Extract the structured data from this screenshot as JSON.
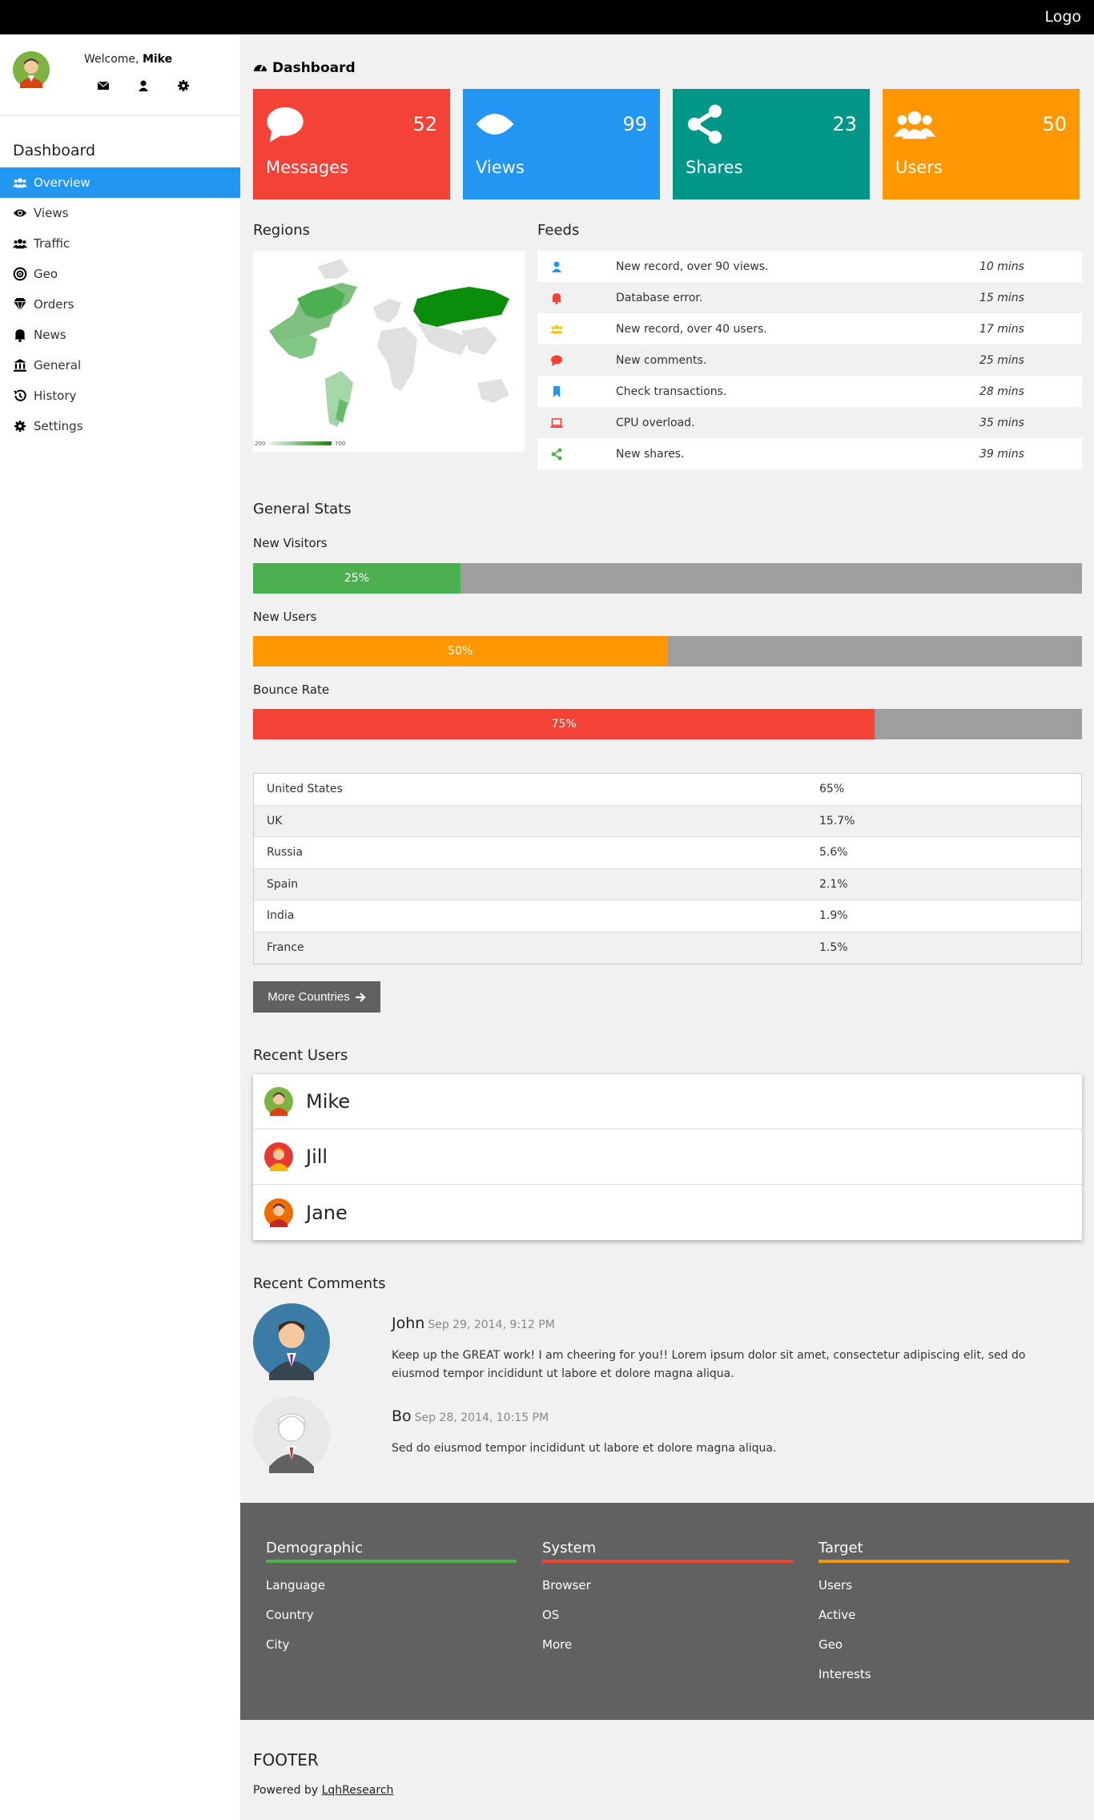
{
  "topbar": {
    "logo": "Logo"
  },
  "profile": {
    "welcome_prefix": "Welcome,",
    "user_name": "Mike"
  },
  "sidebar": {
    "title": "Dashboard",
    "items": [
      {
        "label": "Overview",
        "icon": "users-icon",
        "active": true
      },
      {
        "label": "Views",
        "icon": "eye-icon"
      },
      {
        "label": "Traffic",
        "icon": "users-icon"
      },
      {
        "label": "Geo",
        "icon": "bullseye-icon"
      },
      {
        "label": "Orders",
        "icon": "diamond-icon"
      },
      {
        "label": "News",
        "icon": "bell-icon"
      },
      {
        "label": "General",
        "icon": "bank-icon"
      },
      {
        "label": "History",
        "icon": "history-icon"
      },
      {
        "label": "Settings",
        "icon": "gear-icon"
      }
    ]
  },
  "main": {
    "title": "Dashboard",
    "cards": [
      {
        "label": "Messages",
        "value": "52",
        "color": "#f44336",
        "icon": "comment-icon"
      },
      {
        "label": "Views",
        "value": "99",
        "color": "#2196F3",
        "icon": "eye-icon"
      },
      {
        "label": "Shares",
        "value": "23",
        "color": "#009688",
        "icon": "share-icon"
      },
      {
        "label": "Users",
        "value": "50",
        "color": "#ff9800",
        "icon": "users-icon"
      }
    ],
    "regions_title": "Regions",
    "map_legend_min": "200",
    "map_legend_max": "700",
    "feeds_title": "Feeds",
    "feeds": [
      {
        "text": "New record, over 90 views.",
        "time": "10 mins",
        "icon": "user-icon",
        "color": "#2196F3"
      },
      {
        "text": "Database error.",
        "time": "15 mins",
        "icon": "bell-icon",
        "color": "#f44336"
      },
      {
        "text": "New record, over 40 users.",
        "time": "17 mins",
        "icon": "users-icon",
        "color": "#ffc107"
      },
      {
        "text": "New comments.",
        "time": "25 mins",
        "icon": "comment-icon",
        "color": "#f44336"
      },
      {
        "text": "Check transactions.",
        "time": "28 mins",
        "icon": "bookmark-icon",
        "color": "#2196F3"
      },
      {
        "text": "CPU overload.",
        "time": "35 mins",
        "icon": "laptop-icon",
        "color": "#f44336"
      },
      {
        "text": "New shares.",
        "time": "39 mins",
        "icon": "share-icon",
        "color": "#4CAF50"
      }
    ],
    "stats_title": "General Stats",
    "stats": [
      {
        "label": "New Visitors",
        "value": 25,
        "text": "25%",
        "color": "#4CAF50"
      },
      {
        "label": "New Users",
        "value": 50,
        "text": "50%",
        "color": "#ff9800"
      },
      {
        "label": "Bounce Rate",
        "value": 75,
        "text": "75%",
        "color": "#f44336"
      }
    ],
    "countries": [
      {
        "name": "United States",
        "value": "65%"
      },
      {
        "name": "UK",
        "value": "15.7%"
      },
      {
        "name": "Russia",
        "value": "5.6%"
      },
      {
        "name": "Spain",
        "value": "2.1%"
      },
      {
        "name": "India",
        "value": "1.9%"
      },
      {
        "name": "France",
        "value": "1.5%"
      }
    ],
    "more_countries": "More Countries",
    "recent_users_title": "Recent Users",
    "recent_users": [
      {
        "name": "Mike"
      },
      {
        "name": "Jill"
      },
      {
        "name": "Jane"
      }
    ],
    "recent_comments_title": "Recent Comments",
    "comments": [
      {
        "author": "John",
        "date": "Sep 29, 2014, 9:12 PM",
        "text": "Keep up the GREAT work! I am cheering for you!! Lorem ipsum dolor sit amet, consectetur adipiscing elit, sed do eiusmod tempor incididunt ut labore et dolore magna aliqua."
      },
      {
        "author": "Bo",
        "date": "Sep 28, 2014, 10:15 PM",
        "text": "Sed do eiusmod tempor incididunt ut labore et dolore magna aliqua."
      }
    ]
  },
  "footer": {
    "columns": [
      {
        "title": "Demographic",
        "color": "#4CAF50",
        "links": [
          "Language",
          "Country",
          "City"
        ]
      },
      {
        "title": "System",
        "color": "#f44336",
        "links": [
          "Browser",
          "OS",
          "More"
        ]
      },
      {
        "title": "Target",
        "color": "#ff9800",
        "links": [
          "Users",
          "Active",
          "Geo",
          "Interests"
        ]
      }
    ],
    "title": "FOOTER",
    "powered_prefix": "Powered by",
    "powered_link": "LqhResearch"
  }
}
